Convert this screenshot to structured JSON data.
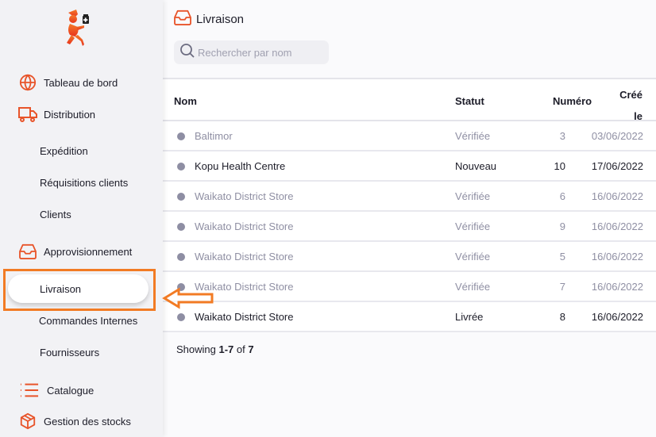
{
  "sidebar": {
    "items": [
      {
        "label": "Tableau de bord",
        "icon": "globe-icon"
      },
      {
        "label": "Distribution",
        "icon": "truck-icon"
      },
      {
        "label": "Expédition"
      },
      {
        "label": "Réquisitions clients"
      },
      {
        "label": "Clients"
      },
      {
        "label": "Approvisionnement",
        "icon": "inbox-icon"
      },
      {
        "label": "Livraison",
        "active": true
      },
      {
        "label": "Commandes Internes"
      },
      {
        "label": "Fournisseurs"
      },
      {
        "label": "Catalogue",
        "icon": "list-icon"
      },
      {
        "label": "Gestion des stocks",
        "icon": "box-icon"
      }
    ]
  },
  "header": {
    "title": "Livraison",
    "icon": "inbox-icon"
  },
  "search": {
    "placeholder": "Rechercher par nom",
    "value": ""
  },
  "table": {
    "columns": [
      "Nom",
      "Statut",
      "Numéro",
      "Créé le"
    ],
    "column_cree_line1": "Créé",
    "column_cree_line2": "le",
    "rows": [
      {
        "name": "Baltimor",
        "status": "Vérifiée",
        "number": "3",
        "created": "03/06/2022",
        "style": "dim"
      },
      {
        "name": "Kopu Health Centre",
        "status": "Nouveau",
        "number": "10",
        "created": "17/06/2022",
        "style": "bright"
      },
      {
        "name": "Waikato District Store",
        "status": "Vérifiée",
        "number": "6",
        "created": "16/06/2022",
        "style": "dim"
      },
      {
        "name": "Waikato District Store",
        "status": "Vérifiée",
        "number": "9",
        "created": "16/06/2022",
        "style": "dim"
      },
      {
        "name": "Waikato District Store",
        "status": "Vérifiée",
        "number": "5",
        "created": "16/06/2022",
        "style": "dim"
      },
      {
        "name": "Waikato District Store",
        "status": "Vérifiée",
        "number": "7",
        "created": "16/06/2022",
        "style": "dim"
      },
      {
        "name": "Waikato District Store",
        "status": "Livrée",
        "number": "8",
        "created": "16/06/2022",
        "style": "bright"
      }
    ]
  },
  "footer": {
    "prefix": "Showing",
    "range": "1-7",
    "of": "of",
    "total": "7"
  },
  "colors": {
    "accent": "#e8542a",
    "highlight": "#f27b24"
  }
}
